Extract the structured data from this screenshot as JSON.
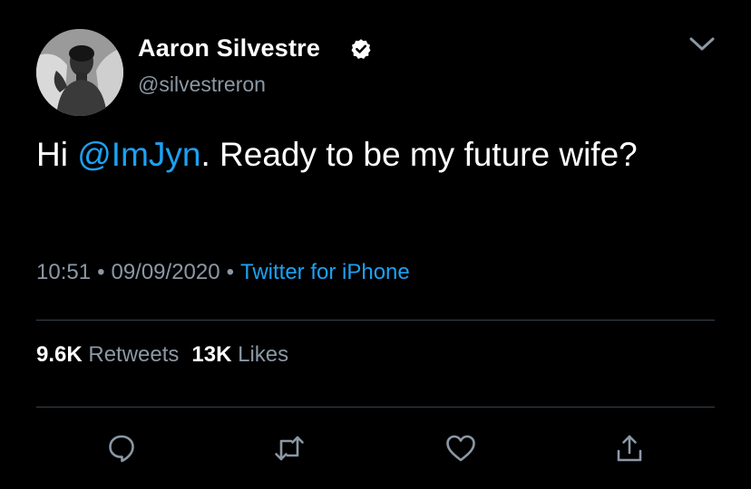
{
  "author": {
    "display_name": "Aaron Silvestre",
    "handle": "@silvestreron",
    "verified": true,
    "avatar_icon": "profile-photo"
  },
  "tweet": {
    "text_prefix": "Hi ",
    "mention": "@ImJyn",
    "text_suffix": ". Ready to be my future wife?"
  },
  "meta": {
    "time": "10:51",
    "separator": "•",
    "date": "09/09/2020",
    "source": "Twitter for iPhone"
  },
  "stats": {
    "retweets_count": "9.6K",
    "retweets_label": "Retweets",
    "likes_count": "13K",
    "likes_label": "Likes"
  },
  "actions": [
    "reply-icon",
    "retweet-icon",
    "like-icon",
    "share-icon"
  ],
  "colors": {
    "background": "#000000",
    "text": "#ffffff",
    "secondary": "#8b98a5",
    "accent": "#1da1f2",
    "divider": "#38444d"
  }
}
